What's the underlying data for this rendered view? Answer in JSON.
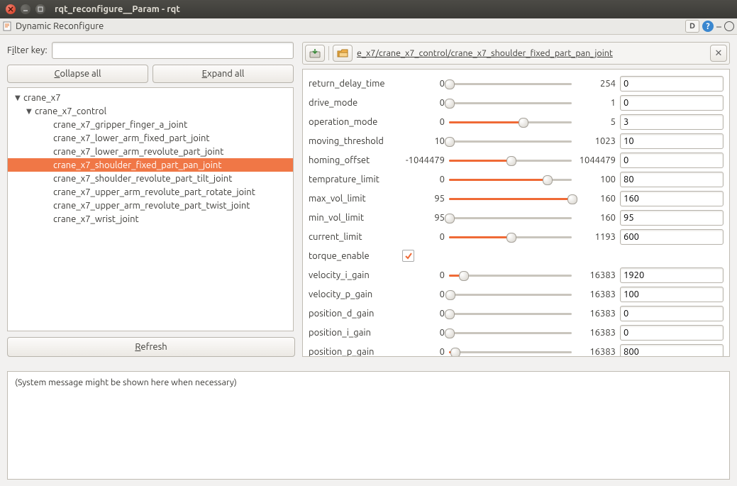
{
  "window": {
    "title": "rqt_reconfigure__Param - rqt"
  },
  "menubar": {
    "label": "Dynamic Reconfigure",
    "d_label": "D"
  },
  "filter": {
    "label_pre": "F",
    "label_ul": "i",
    "label_post": "lter key:",
    "value": ""
  },
  "buttons": {
    "collapse_pre": "",
    "collapse_ul": "C",
    "collapse_post": "ollapse all",
    "expand_pre": "",
    "expand_ul": "E",
    "expand_post": "xpand all",
    "refresh_pre": "",
    "refresh_ul": "R",
    "refresh_post": "efresh"
  },
  "tree": {
    "root": "crane_x7",
    "ctrl": "crane_x7_control",
    "items": [
      "crane_x7_gripper_finger_a_joint",
      "crane_x7_lower_arm_fixed_part_joint",
      "crane_x7_lower_arm_revolute_part_joint",
      "crane_x7_shoulder_fixed_part_pan_joint",
      "crane_x7_shoulder_revolute_part_tilt_joint",
      "crane_x7_upper_arm_revolute_part_rotate_joint",
      "crane_x7_upper_arm_revolute_part_twist_joint",
      "crane_x7_wrist_joint"
    ],
    "selected_index": 3
  },
  "breadcrumb": "e_x7/crane_x7_control/crane_x7_shoulder_fixed_part_pan_joint",
  "params": [
    {
      "name": "return_delay_time",
      "min": 0,
      "max": 254,
      "val": 0,
      "frac": 0.0,
      "type": "slider"
    },
    {
      "name": "drive_mode",
      "min": 0,
      "max": 1,
      "val": 0,
      "frac": 0.0,
      "type": "slider"
    },
    {
      "name": "operation_mode",
      "min": 0,
      "max": 5,
      "val": 3,
      "frac": 0.6,
      "type": "slider"
    },
    {
      "name": "moving_threshold",
      "min": 10,
      "max": 1023,
      "val": 10,
      "frac": 0.0,
      "type": "slider"
    },
    {
      "name": "homing_offset",
      "min": -1044479,
      "max": 1044479,
      "val": 0,
      "frac": 0.5,
      "type": "slider"
    },
    {
      "name": "temprature_limit",
      "min": 0,
      "max": 100,
      "val": 80,
      "frac": 0.8,
      "type": "slider"
    },
    {
      "name": "max_vol_limit",
      "min": 95,
      "max": 160,
      "val": 160,
      "frac": 1.0,
      "type": "slider"
    },
    {
      "name": "min_vol_limit",
      "min": 95,
      "max": 160,
      "val": 95,
      "frac": 0.0,
      "type": "slider"
    },
    {
      "name": "current_limit",
      "min": 0,
      "max": 1193,
      "val": 600,
      "frac": 0.503,
      "type": "slider"
    },
    {
      "name": "torque_enable",
      "checked": true,
      "type": "check"
    },
    {
      "name": "velocity_i_gain",
      "min": 0,
      "max": 16383,
      "val": 1920,
      "frac": 0.117,
      "type": "slider"
    },
    {
      "name": "velocity_p_gain",
      "min": 0,
      "max": 16383,
      "val": 100,
      "frac": 0.006,
      "type": "slider"
    },
    {
      "name": "position_d_gain",
      "min": 0,
      "max": 16383,
      "val": 0,
      "frac": 0.0,
      "type": "slider"
    },
    {
      "name": "position_i_gain",
      "min": 0,
      "max": 16383,
      "val": 0,
      "frac": 0.0,
      "type": "slider"
    },
    {
      "name": "position_p_gain",
      "min": 0,
      "max": 16383,
      "val": 800,
      "frac": 0.049,
      "type": "slider"
    }
  ],
  "message_area": "(System message might be shown here when necessary)"
}
